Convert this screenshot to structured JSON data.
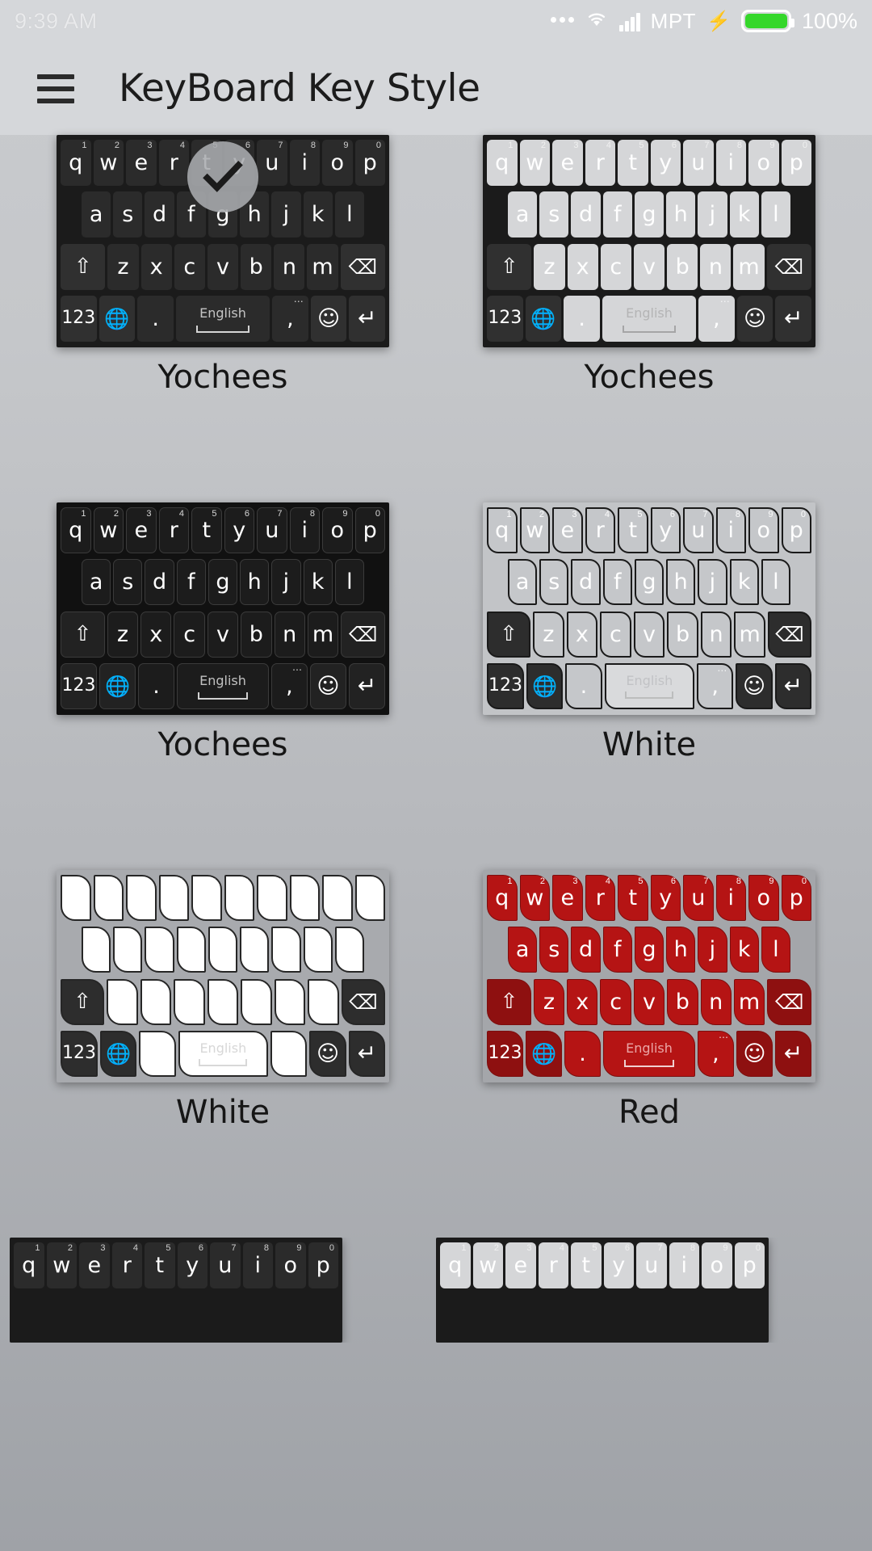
{
  "status_bar": {
    "time": "9:39 AM",
    "carrier": "MPT",
    "battery_pct": "100%",
    "charging_icon": "⚡",
    "icons": [
      "dots-icon",
      "wifi-icon",
      "signal-icon",
      "charging-bolt-icon",
      "battery-icon"
    ]
  },
  "app_bar": {
    "menu_icon": "hamburger-menu-icon",
    "title": "KeyBoard Key Style"
  },
  "keyboard_layout": {
    "row1": [
      "q",
      "w",
      "e",
      "r",
      "t",
      "y",
      "u",
      "i",
      "o",
      "p"
    ],
    "row1_numbers": [
      "1",
      "2",
      "3",
      "4",
      "5",
      "6",
      "7",
      "8",
      "9",
      "0"
    ],
    "row2": [
      "a",
      "s",
      "d",
      "f",
      "g",
      "h",
      "j",
      "k",
      "l"
    ],
    "row3_letters": [
      "z",
      "x",
      "c",
      "v",
      "b",
      "n",
      "m"
    ],
    "shift_label": "⇧",
    "backspace_label": "⌫",
    "numeric_label": "123",
    "globe_label": "🌐",
    "period_label": ".",
    "space_label": "English",
    "comma_label": ",",
    "emoji_label": "☺",
    "enter_label": "↵"
  },
  "themes": [
    {
      "id": "theme-1",
      "name": "Yochees",
      "style": "t-dark",
      "selected": true,
      "globe_color": "#ffffff",
      "show_letters": true
    },
    {
      "id": "theme-2",
      "name": "Yochees",
      "style": "t-lightkeys",
      "selected": false,
      "globe_color": "#ffffff",
      "show_letters": true
    },
    {
      "id": "theme-3",
      "name": "Yochees",
      "style": "t-darkline",
      "selected": false,
      "globe_color": "#ffffff",
      "show_letters": true
    },
    {
      "id": "theme-4",
      "name": "White",
      "style": "t-white",
      "selected": false,
      "globe_color": "#29b6e8",
      "show_letters": true
    },
    {
      "id": "theme-5",
      "name": "White",
      "style": "t-purewhite",
      "selected": false,
      "globe_color": "#29b6e8",
      "show_letters": false
    },
    {
      "id": "theme-6",
      "name": "Red",
      "style": "t-red",
      "selected": false,
      "globe_color": "#29b6e8",
      "show_letters": true
    }
  ],
  "partial_row": [
    {
      "id": "theme-7",
      "style": "t-dark"
    },
    {
      "id": "theme-8",
      "style": "t-lightkeys"
    }
  ],
  "colors": {
    "page_bg": "#bcbec2",
    "appbar_bg": "#d5d7da",
    "title_text": "#1c1c1c",
    "battery_green": "#35d72b",
    "red_key": "#b51414",
    "globe_blue": "#29b6e8"
  }
}
